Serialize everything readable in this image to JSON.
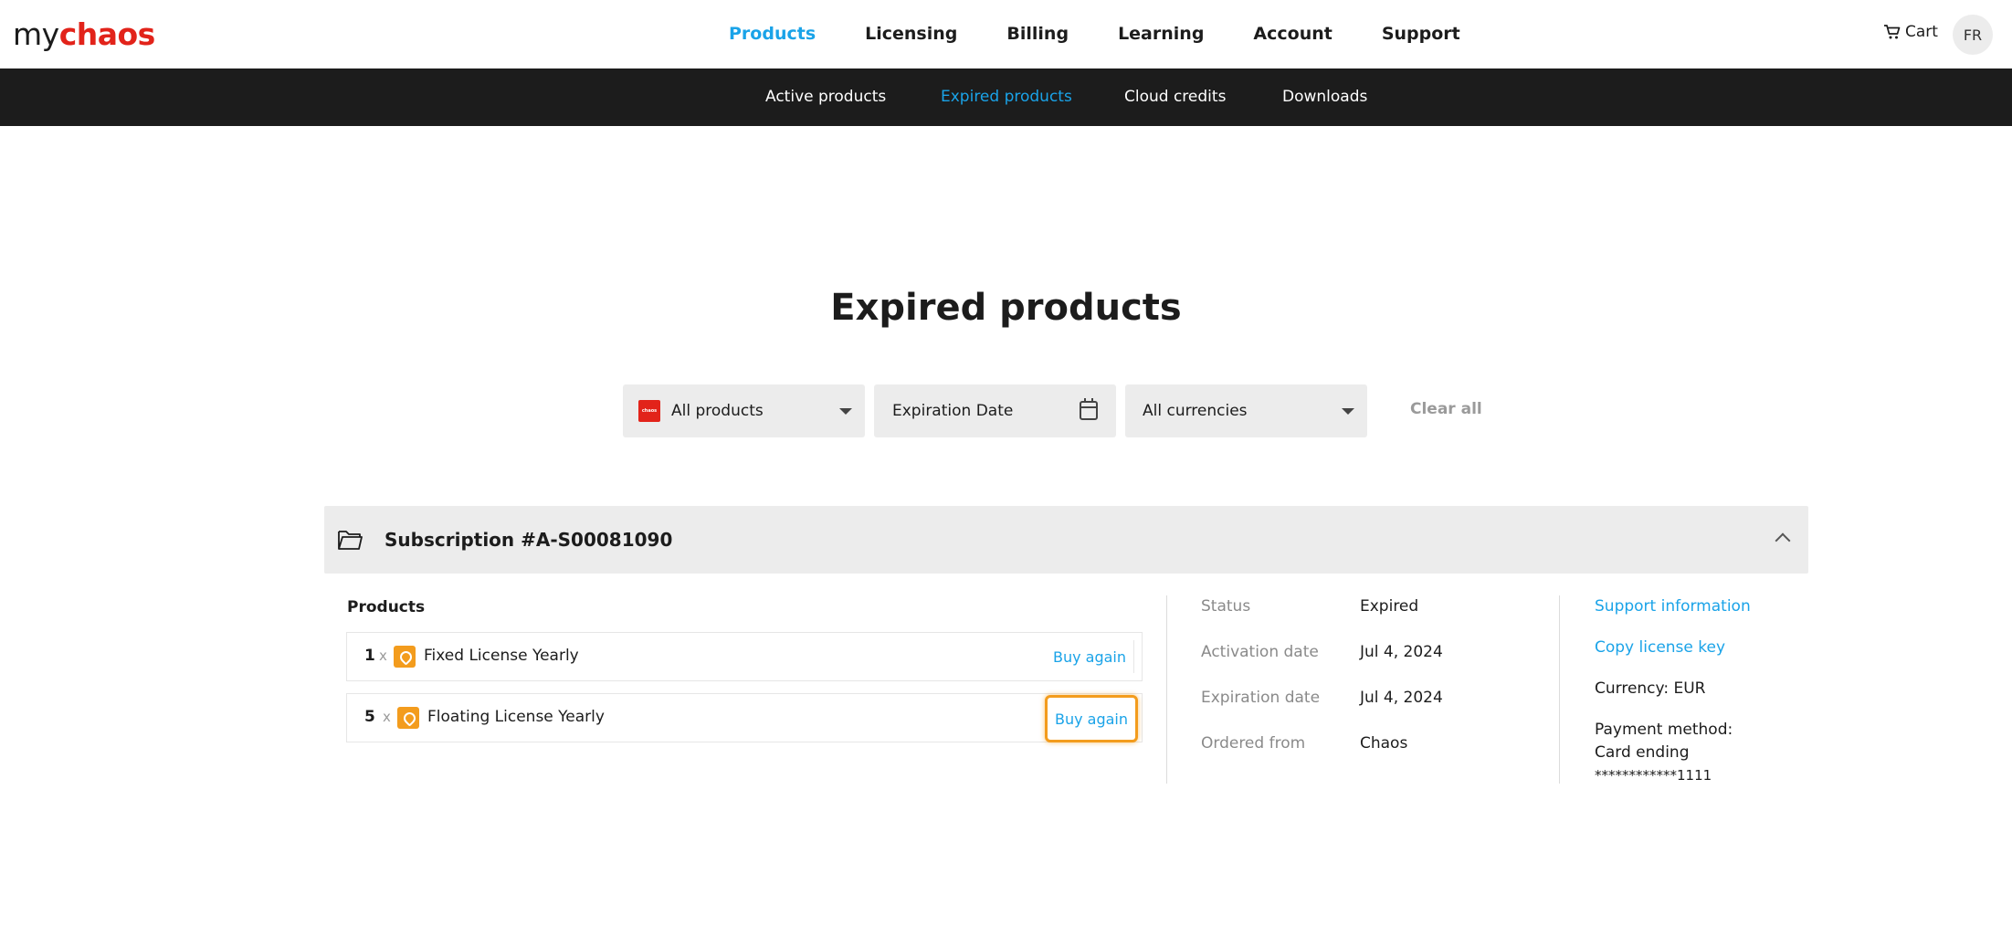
{
  "header": {
    "logo_my": "my",
    "logo_chaos": "chaos",
    "nav": [
      {
        "label": "Products",
        "active": true
      },
      {
        "label": "Licensing",
        "active": false
      },
      {
        "label": "Billing",
        "active": false
      },
      {
        "label": "Learning",
        "active": false
      },
      {
        "label": "Account",
        "active": false
      },
      {
        "label": "Support",
        "active": false
      }
    ],
    "cart_label": "Cart",
    "avatar_initials": "FR"
  },
  "subnav": {
    "items": [
      {
        "label": "Active products",
        "active": false
      },
      {
        "label": "Expired products",
        "active": true
      },
      {
        "label": "Cloud credits",
        "active": false
      },
      {
        "label": "Downloads",
        "active": false
      }
    ]
  },
  "page_title": "Expired products",
  "filters": {
    "products": "All products",
    "products_chip": "chaos",
    "expiration": "Expiration Date",
    "currencies": "All currencies",
    "clear_all": "Clear all"
  },
  "subscription": {
    "title": "Subscription #A-S00081090",
    "products_label": "Products",
    "products": [
      {
        "qty": "1",
        "times": "x",
        "name": "Fixed License Yearly",
        "action": "Buy again"
      },
      {
        "qty": "5",
        "times": "x",
        "name": "Floating License Yearly",
        "action": "Buy again"
      }
    ],
    "details": [
      {
        "label": "Status",
        "value": "Expired"
      },
      {
        "label": "Activation date",
        "value": "Jul 4, 2024"
      },
      {
        "label": "Expiration date",
        "value": "Jul 4, 2024"
      },
      {
        "label": "Ordered from",
        "value": "Chaos"
      }
    ],
    "support_link": "Support information",
    "copy_link": "Copy license key",
    "currency": "Currency: EUR",
    "payment_label": "Payment method:",
    "payment_card": "Card ending",
    "payment_number": "************1111"
  },
  "colors": {
    "accent": "#1aa3e8",
    "brand_red": "#e2231a",
    "highlight": "#f39c1d",
    "dark_bar": "#1c1c1c"
  }
}
